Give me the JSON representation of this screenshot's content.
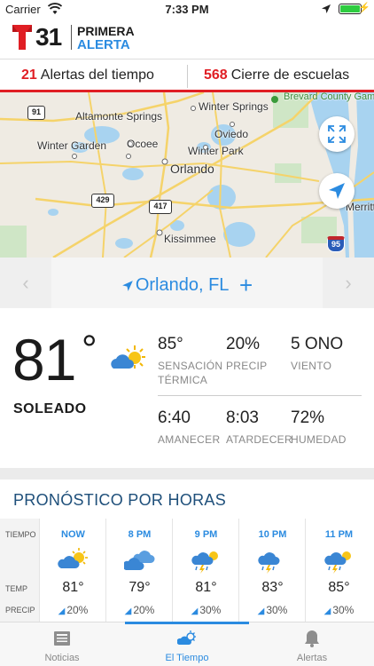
{
  "status_bar": {
    "carrier": "Carrier",
    "time": "7:33 PM"
  },
  "header": {
    "logo_number": "31",
    "logo_line1": "PRIMERA",
    "logo_line2": "ALERTA"
  },
  "alerts": {
    "weather_count": "21",
    "weather_label": "Alertas del tiempo",
    "schools_count": "568",
    "schools_label": "Cierre de escuelas"
  },
  "map": {
    "labels": [
      "Altamonte Springs",
      "Winter Springs",
      "Oviedo",
      "Winter Garden",
      "Ocoee",
      "Winter Park",
      "Orlando",
      "Kissimmee",
      "Merritt",
      "Brevard County Game Refuge"
    ],
    "route_shields": [
      "91",
      "429",
      "417",
      "95"
    ]
  },
  "location": {
    "name": "Orlando, FL",
    "prev_icon": "chevron-left-icon",
    "next_icon": "chevron-right-icon",
    "add": "+"
  },
  "current": {
    "temp": "81",
    "deg": "°",
    "condition": "SOLEADO",
    "feels_like": {
      "value": "85°",
      "label": "SENSACIÓN TÉRMICA"
    },
    "precip": {
      "value": "20%",
      "label": "PRECIP"
    },
    "wind": {
      "value": "5 ONO",
      "label": "VIENTO"
    },
    "sunrise": {
      "value": "6:40",
      "label": "AMANECER"
    },
    "sunset": {
      "value": "8:03",
      "label": "ATARDECER"
    },
    "humidity": {
      "value": "72%",
      "label": "HUMEDAD"
    }
  },
  "hourly": {
    "title": "PRONÓSTICO POR HORAS",
    "row_labels": {
      "time": "TIEMPO",
      "temp": "TEMP",
      "precip": "PRECIP"
    },
    "hours": [
      {
        "time": "NOW",
        "temp": "81°",
        "precip": "20%",
        "icon": "partly-sunny-icon"
      },
      {
        "time": "8 PM",
        "temp": "79°",
        "precip": "20%",
        "icon": "cloudy-icon"
      },
      {
        "time": "9 PM",
        "temp": "81°",
        "precip": "30%",
        "icon": "thunderstorm-sun-icon"
      },
      {
        "time": "10 PM",
        "temp": "83°",
        "precip": "30%",
        "icon": "thunderstorm-icon"
      },
      {
        "time": "11 PM",
        "temp": "85°",
        "precip": "30%",
        "icon": "thunderstorm-sun-icon"
      }
    ]
  },
  "tabs": [
    {
      "label": "Noticias",
      "icon": "news-icon"
    },
    {
      "label": "El Tiempo",
      "icon": "weather-icon",
      "active": true
    },
    {
      "label": "Alertas",
      "icon": "bell-icon"
    }
  ],
  "colors": {
    "accent": "#2b8be0",
    "alert_red": "#e01e24",
    "title_blue": "#1e4f7a"
  }
}
